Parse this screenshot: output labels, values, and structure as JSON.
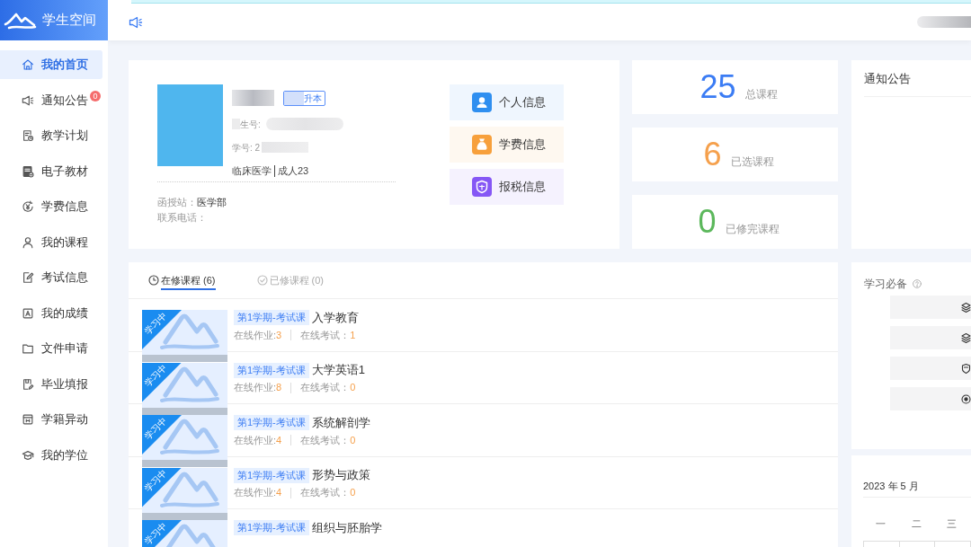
{
  "sidebar": {
    "title": "学生空间",
    "items": [
      {
        "label": "我的首页",
        "selected": true
      },
      {
        "label": "通知公告",
        "selected": false,
        "badge": "0"
      },
      {
        "label": "教学计划",
        "selected": false
      },
      {
        "label": "电子教材",
        "selected": false
      },
      {
        "label": "学费信息",
        "selected": false
      },
      {
        "label": "我的课程",
        "selected": false
      },
      {
        "label": "考试信息",
        "selected": false
      },
      {
        "label": "我的成绩",
        "selected": false
      },
      {
        "label": "文件申请",
        "selected": false
      },
      {
        "label": "毕业填报",
        "selected": false
      },
      {
        "label": "学籍异动",
        "selected": false
      },
      {
        "label": "我的学位",
        "selected": false
      }
    ]
  },
  "profile": {
    "program_tag": "升本",
    "candidate_number_label": "生号:",
    "student_number_label": "学号: 2",
    "major": "临床医学",
    "class": "成人23",
    "station_label": "函授站：",
    "station": "医学部",
    "phone_label": "联系电话："
  },
  "quick_links": [
    {
      "label": "个人信息",
      "color": "#2f8ff0"
    },
    {
      "label": "学费信息",
      "color": "#f7a03c"
    },
    {
      "label": "报税信息",
      "color": "#8557f5"
    }
  ],
  "stats": [
    {
      "value": "25",
      "label": "总课程",
      "color": "#3b7cf4"
    },
    {
      "value": "6",
      "label": "已选课程",
      "color": "#f5a04c"
    },
    {
      "value": "0",
      "label": "已修完课程",
      "color": "#5cb85c"
    }
  ],
  "notices": {
    "title": "通知公告"
  },
  "courses": {
    "tabs": [
      {
        "label": "在修课程 (6)",
        "selected": true
      },
      {
        "label": "已修课程 (0)",
        "selected": false
      }
    ],
    "rows": [
      {
        "status": "学习中",
        "term": "第1学期-考试课",
        "title": "入学教育",
        "homework_label": "在线作业:",
        "homework": "3",
        "exam_label": "在线考试：",
        "exam": "1"
      },
      {
        "status": "学习中",
        "term": "第1学期-考试课",
        "title": "大学英语1",
        "homework_label": "在线作业:",
        "homework": "8",
        "exam_label": "在线考试：",
        "exam": "0"
      },
      {
        "status": "学习中",
        "term": "第1学期-考试课",
        "title": "系统解剖学",
        "homework_label": "在线作业:",
        "homework": "4",
        "exam_label": "在线考试：",
        "exam": "0"
      },
      {
        "status": "学习中",
        "term": "第1学期-考试课",
        "title": "形势与政策",
        "homework_label": "在线作业:",
        "homework": "4",
        "exam_label": "在线考试：",
        "exam": "0"
      },
      {
        "status": "学习中",
        "term": "第1学期-考试课",
        "title": "组织与胚胎学"
      }
    ]
  },
  "essentials": {
    "title": "学习必备"
  },
  "calendar": {
    "title": "2023 年 5 月",
    "weekdays": [
      "一",
      "二",
      "三"
    ]
  }
}
